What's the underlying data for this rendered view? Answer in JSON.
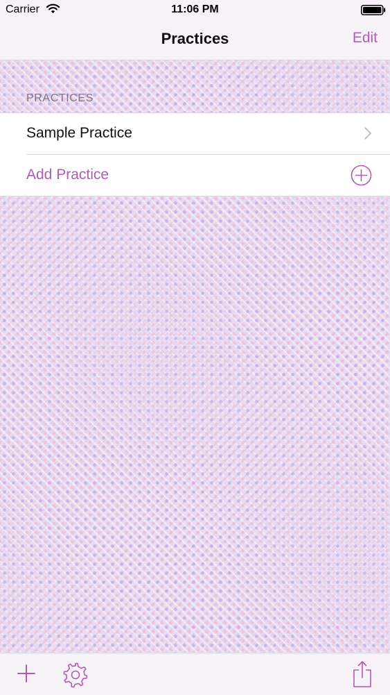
{
  "status_bar": {
    "carrier": "Carrier",
    "time": "11:06 PM"
  },
  "nav": {
    "title": "Practices",
    "edit_label": "Edit"
  },
  "section": {
    "header": "PRACTICES",
    "rows": [
      {
        "label": "Sample Practice",
        "accessory": "chevron-right-icon"
      },
      {
        "label": "Add Practice",
        "accessory": "add-circle-icon"
      }
    ]
  },
  "toolbar": {
    "items": [
      "add-icon",
      "gear-icon",
      "share-icon"
    ]
  },
  "colors": {
    "accent": "#b15bb3",
    "bar_background": "#f7f2f8",
    "separator": "#dcd6df",
    "section_header": "#7b757d"
  }
}
